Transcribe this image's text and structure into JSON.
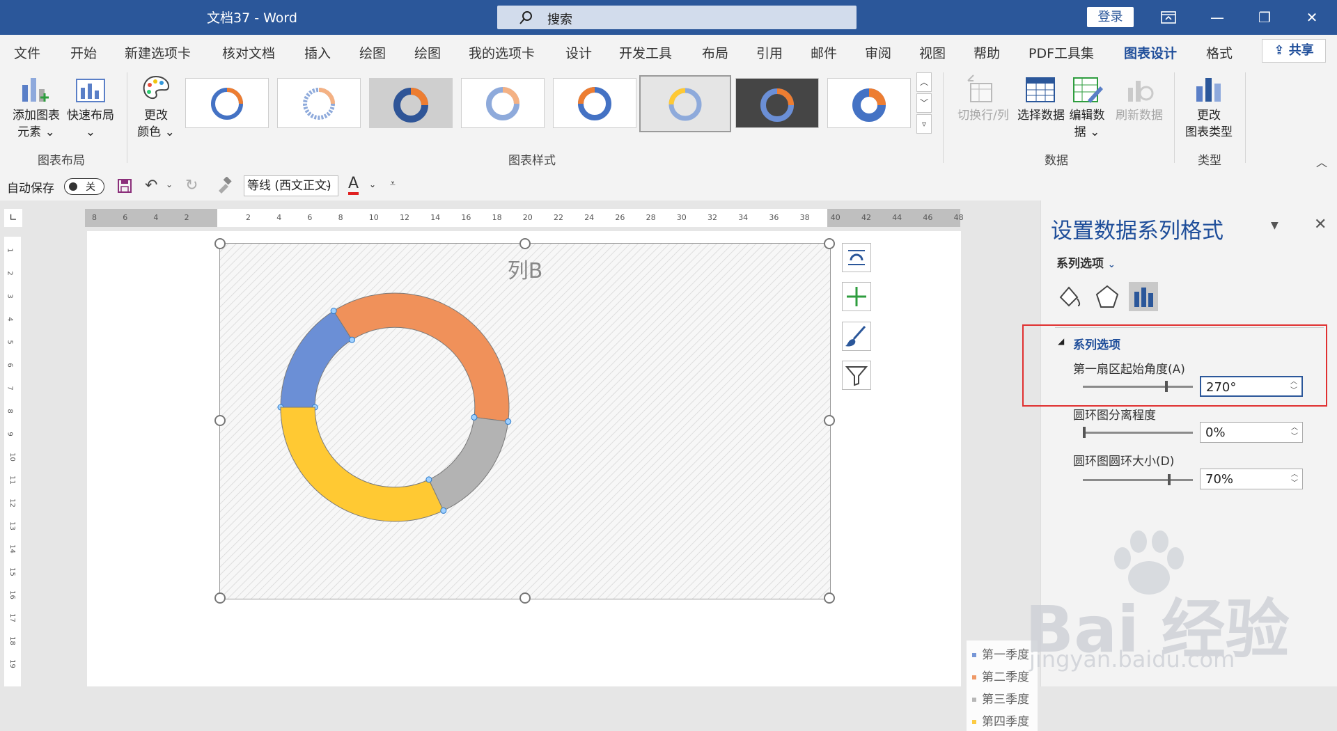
{
  "window": {
    "title": "文档37  -  Word",
    "search_placeholder": "搜索",
    "login": "登录"
  },
  "tabs": [
    "文件",
    "开始",
    "新建选项卡",
    "核对文档",
    "插入",
    "绘图",
    "绘图",
    "我的选项卡",
    "设计",
    "开发工具",
    "布局",
    "引用",
    "邮件",
    "审阅",
    "视图",
    "帮助",
    "PDF工具集",
    "图表设计",
    "格式"
  ],
  "active_tab": "图表设计",
  "share": "共享",
  "ribbon": {
    "add_element": [
      "添加图表",
      "元素 ⌄"
    ],
    "quick_layout": "快速布局",
    "change_color": [
      "更改",
      "颜色 ⌄"
    ],
    "group_layout": "图表布局",
    "group_styles": "图表样式",
    "switch_row_col": "切换行/列",
    "select_data": "选择数据",
    "edit_data": [
      "编辑数",
      "据 ⌄"
    ],
    "refresh_data": "刷新数据",
    "group_data": "数据",
    "change_type": [
      "更改",
      "图表类型"
    ],
    "group_type": "类型"
  },
  "qat": {
    "autosave": "自动保存",
    "toggle": "关",
    "font": "等线 (西文正文)"
  },
  "chart": {
    "title": "列B",
    "legend": [
      "第一季度",
      "第二季度",
      "第三季度",
      "第四季度"
    ]
  },
  "chart_data": {
    "type": "pie",
    "title": "列B",
    "hole": 0.7,
    "start_angle": 270,
    "categories": [
      "第一季度",
      "第二季度",
      "第三季度",
      "第四季度"
    ],
    "values": [
      16,
      36,
      16,
      32
    ],
    "colors": [
      "#6b8fd6",
      "#f0915a",
      "#b3b3b3",
      "#ffc933"
    ],
    "legend_position": "right"
  },
  "pane": {
    "title": "设置数据系列格式",
    "subtitle": "系列选项",
    "section": "系列选项",
    "opt1_label": "第一扇区起始角度(A)",
    "opt1_value": "270°",
    "opt2_label": "圆环图分离程度",
    "opt2_value": "0%",
    "opt3_label": "圆环图圆环大小(D)",
    "opt3_value": "70%"
  },
  "watermark": {
    "brand": "Bai 经验",
    "url": "jingyan.baidu.com"
  }
}
